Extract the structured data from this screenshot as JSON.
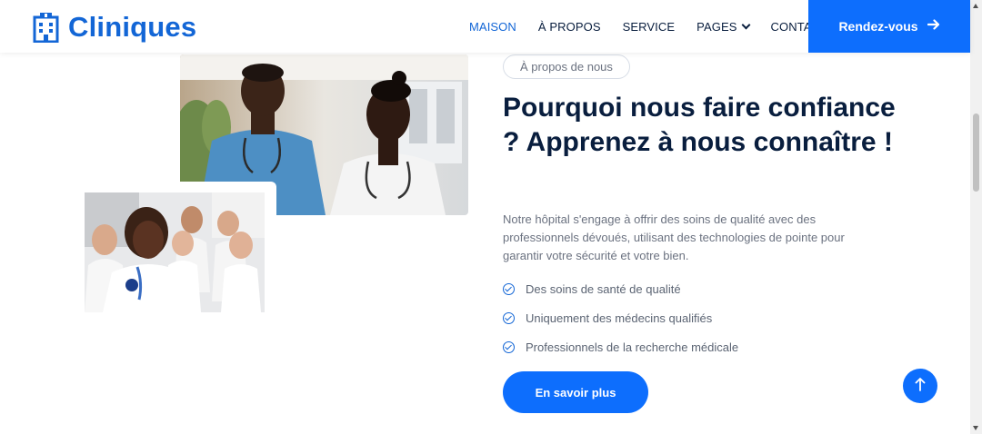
{
  "brand": {
    "name": "Cliniques",
    "icon": "hospital-building-icon",
    "color": "#1366d6"
  },
  "nav": {
    "items": [
      {
        "label": "MAISON",
        "active": true
      },
      {
        "label": "À PROPOS",
        "active": false
      },
      {
        "label": "SERVICE",
        "active": false
      },
      {
        "label": "PAGES",
        "active": false,
        "dropdown": true
      },
      {
        "label": "CONTACT",
        "active": false
      }
    ],
    "cta_label": "Rendez-vous",
    "cta_icon": "arrow-right-icon"
  },
  "about": {
    "badge": "À propos de nous",
    "title": "Pourquoi nous faire confiance ? Apprenez à nous connaître !",
    "description": "Notre hôpital s'engage à offrir des soins de qualité avec des professionnels dévoués, utilisant des technologies de pointe pour garantir votre sécurité et votre bien.",
    "features": [
      "Des soins de santé de qualité",
      "Uniquement des médecins qualifiés",
      "Professionnels de la recherche médicale"
    ],
    "button_label": "En savoir plus"
  },
  "images": {
    "large": "two-medical-staff-talking-photo",
    "small": "smiling-doctor-with-stethoscope-photo"
  },
  "back_to_top_icon": "arrow-up-icon",
  "colors": {
    "accent": "#0d6efd",
    "heading": "#091e3e",
    "muted": "#6b7280"
  }
}
